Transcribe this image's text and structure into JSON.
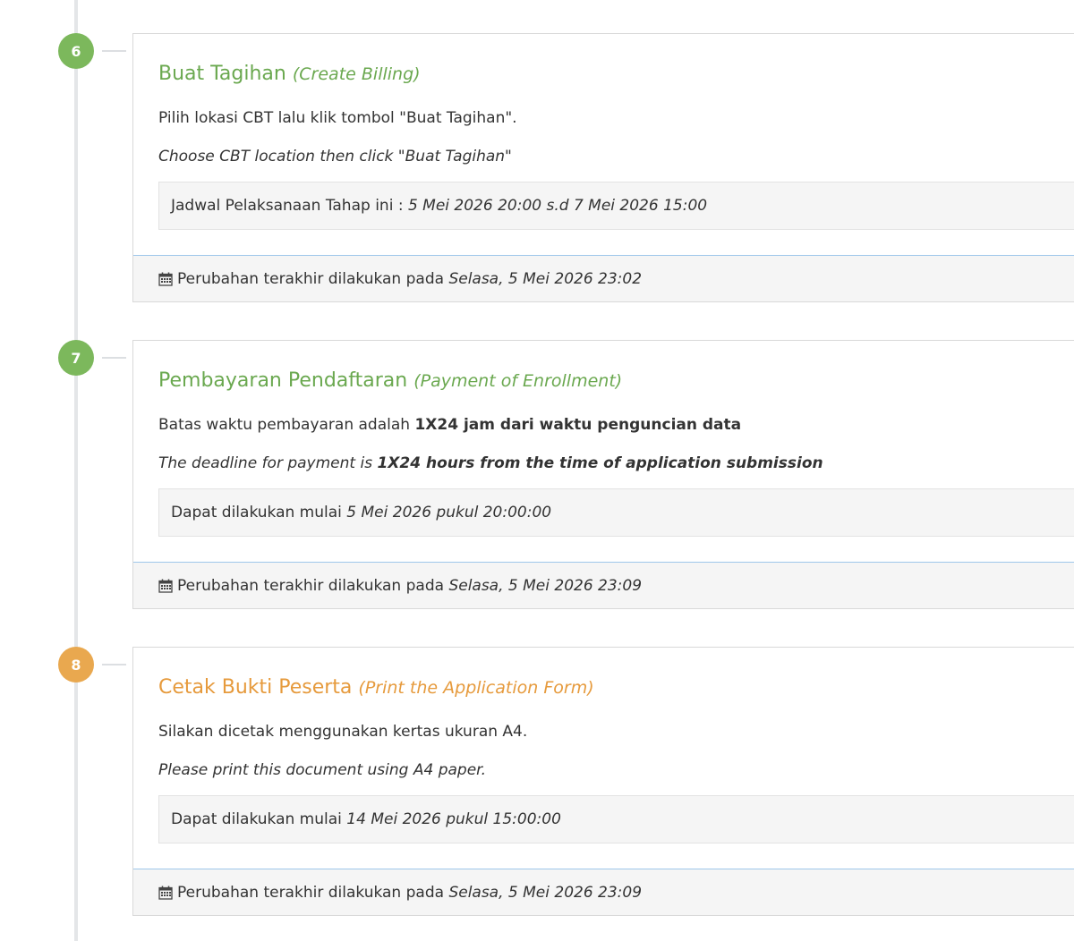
{
  "colors": {
    "green": "#7cb85c",
    "orange": "#e9a84f",
    "footer_border": "#9ec7ea"
  },
  "steps": [
    {
      "number": "6",
      "title": "Buat Tagihan",
      "title_en": "(Create Billing)",
      "desc": "Pilih lokasi CBT lalu klik tombol \"Buat Tagihan\".",
      "desc_en": "Choose CBT location then click \"Buat Tagihan\"",
      "schedule_label": "Jadwal Pelaksanaan Tahap ini : ",
      "schedule_value": "5 Mei 2026 20:00 s.d 7 Mei 2026 15:00",
      "footer_label": "Perubahan terakhir dilakukan pada ",
      "footer_value": "Selasa, 5 Mei 2026 23:02"
    },
    {
      "number": "7",
      "title": "Pembayaran Pendaftaran",
      "title_en": "(Payment of Enrollment)",
      "desc_prefix": "Batas waktu pembayaran adalah ",
      "desc_bold": "1X24 jam dari waktu penguncian data",
      "desc_en_prefix": "The deadline for payment is ",
      "desc_en_bold": "1X24 hours from the time of application submission",
      "schedule_label": "Dapat dilakukan mulai ",
      "schedule_value": "5 Mei 2026 pukul 20:00:00",
      "footer_label": "Perubahan terakhir dilakukan pada ",
      "footer_value": "Selasa, 5 Mei 2026 23:09"
    },
    {
      "number": "8",
      "title": "Cetak Bukti Peserta",
      "title_en": "(Print the Application Form)",
      "desc": "Silakan dicetak menggunakan kertas ukuran A4.",
      "desc_en": "Please print this document using A4 paper.",
      "schedule_label": "Dapat dilakukan mulai ",
      "schedule_value": "14 Mei 2026 pukul 15:00:00",
      "footer_label": "Perubahan terakhir dilakukan pada ",
      "footer_value": "Selasa, 5 Mei 2026 23:09"
    }
  ]
}
